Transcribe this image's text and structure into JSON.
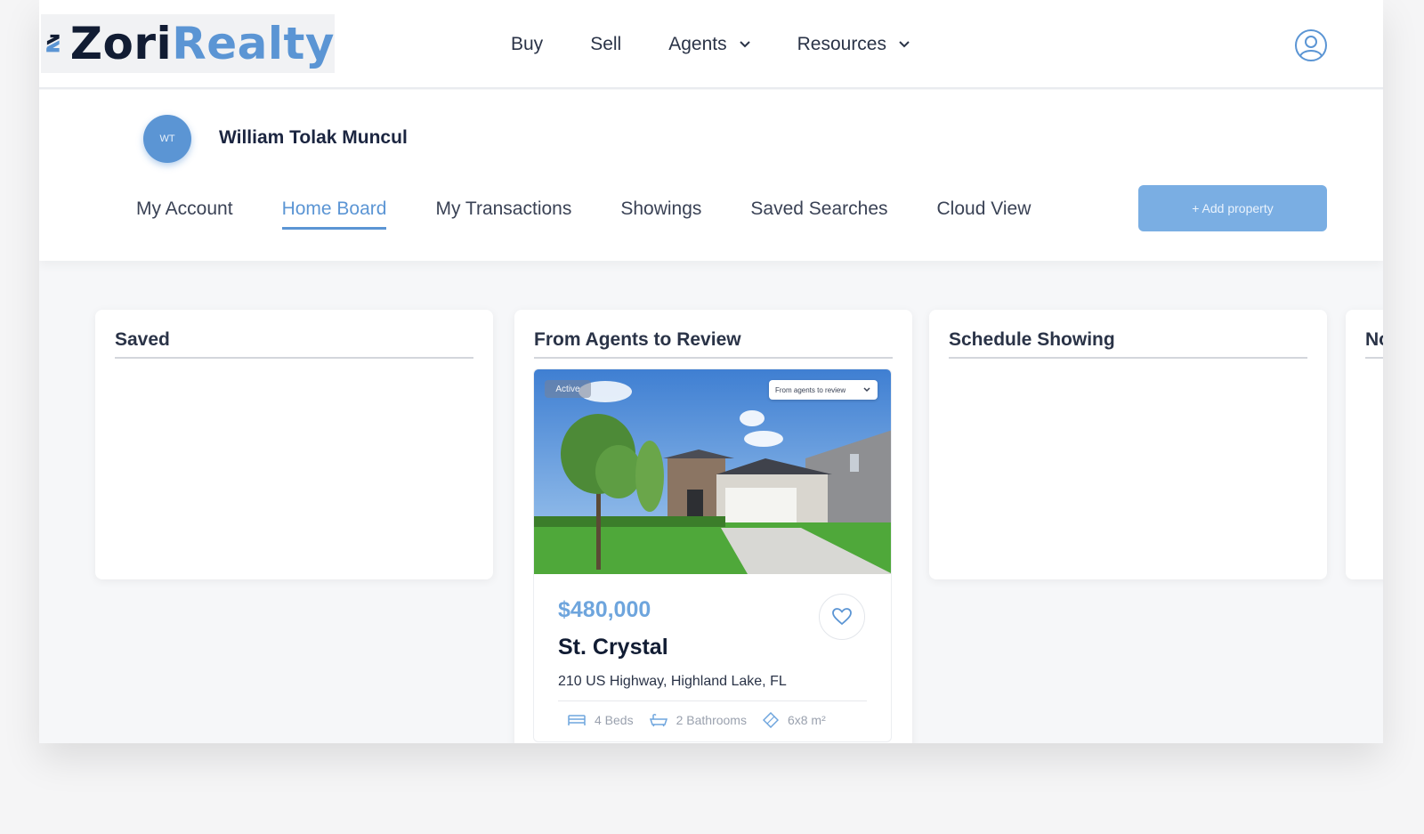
{
  "brand": {
    "name_part1": "Zori",
    "name_part2": "Realty"
  },
  "nav": {
    "items": [
      {
        "label": "Buy",
        "has_dropdown": false
      },
      {
        "label": "Sell",
        "has_dropdown": false
      },
      {
        "label": "Agents",
        "has_dropdown": true
      },
      {
        "label": "Resources",
        "has_dropdown": true
      }
    ],
    "user_icon": "user-circle-icon"
  },
  "profile": {
    "initials": "WT",
    "name": "William Tolak Muncul",
    "tabs": [
      {
        "label": "My Account",
        "active": false
      },
      {
        "label": "Home Board",
        "active": true
      },
      {
        "label": "My Transactions",
        "active": false
      },
      {
        "label": "Showings",
        "active": false
      },
      {
        "label": "Saved Searches",
        "active": false
      },
      {
        "label": "Cloud View",
        "active": false
      }
    ],
    "add_button": "+ Add property"
  },
  "boards": {
    "saved": {
      "title": "Saved"
    },
    "review": {
      "title": "From Agents to Review"
    },
    "schedule": {
      "title": "Schedule Showing"
    },
    "next": {
      "title": "No"
    }
  },
  "property": {
    "status": "Active",
    "source": "From agents to review",
    "price": "$480,000",
    "name": "St. Crystal",
    "address": "210 US Highway, Highland Lake, FL",
    "beds": "4 Beds",
    "baths": "2 Bathrooms",
    "area": "6x8 m²"
  },
  "colors": {
    "accent": "#5b95d4",
    "dark": "#111c33",
    "button": "#7aaee3"
  }
}
